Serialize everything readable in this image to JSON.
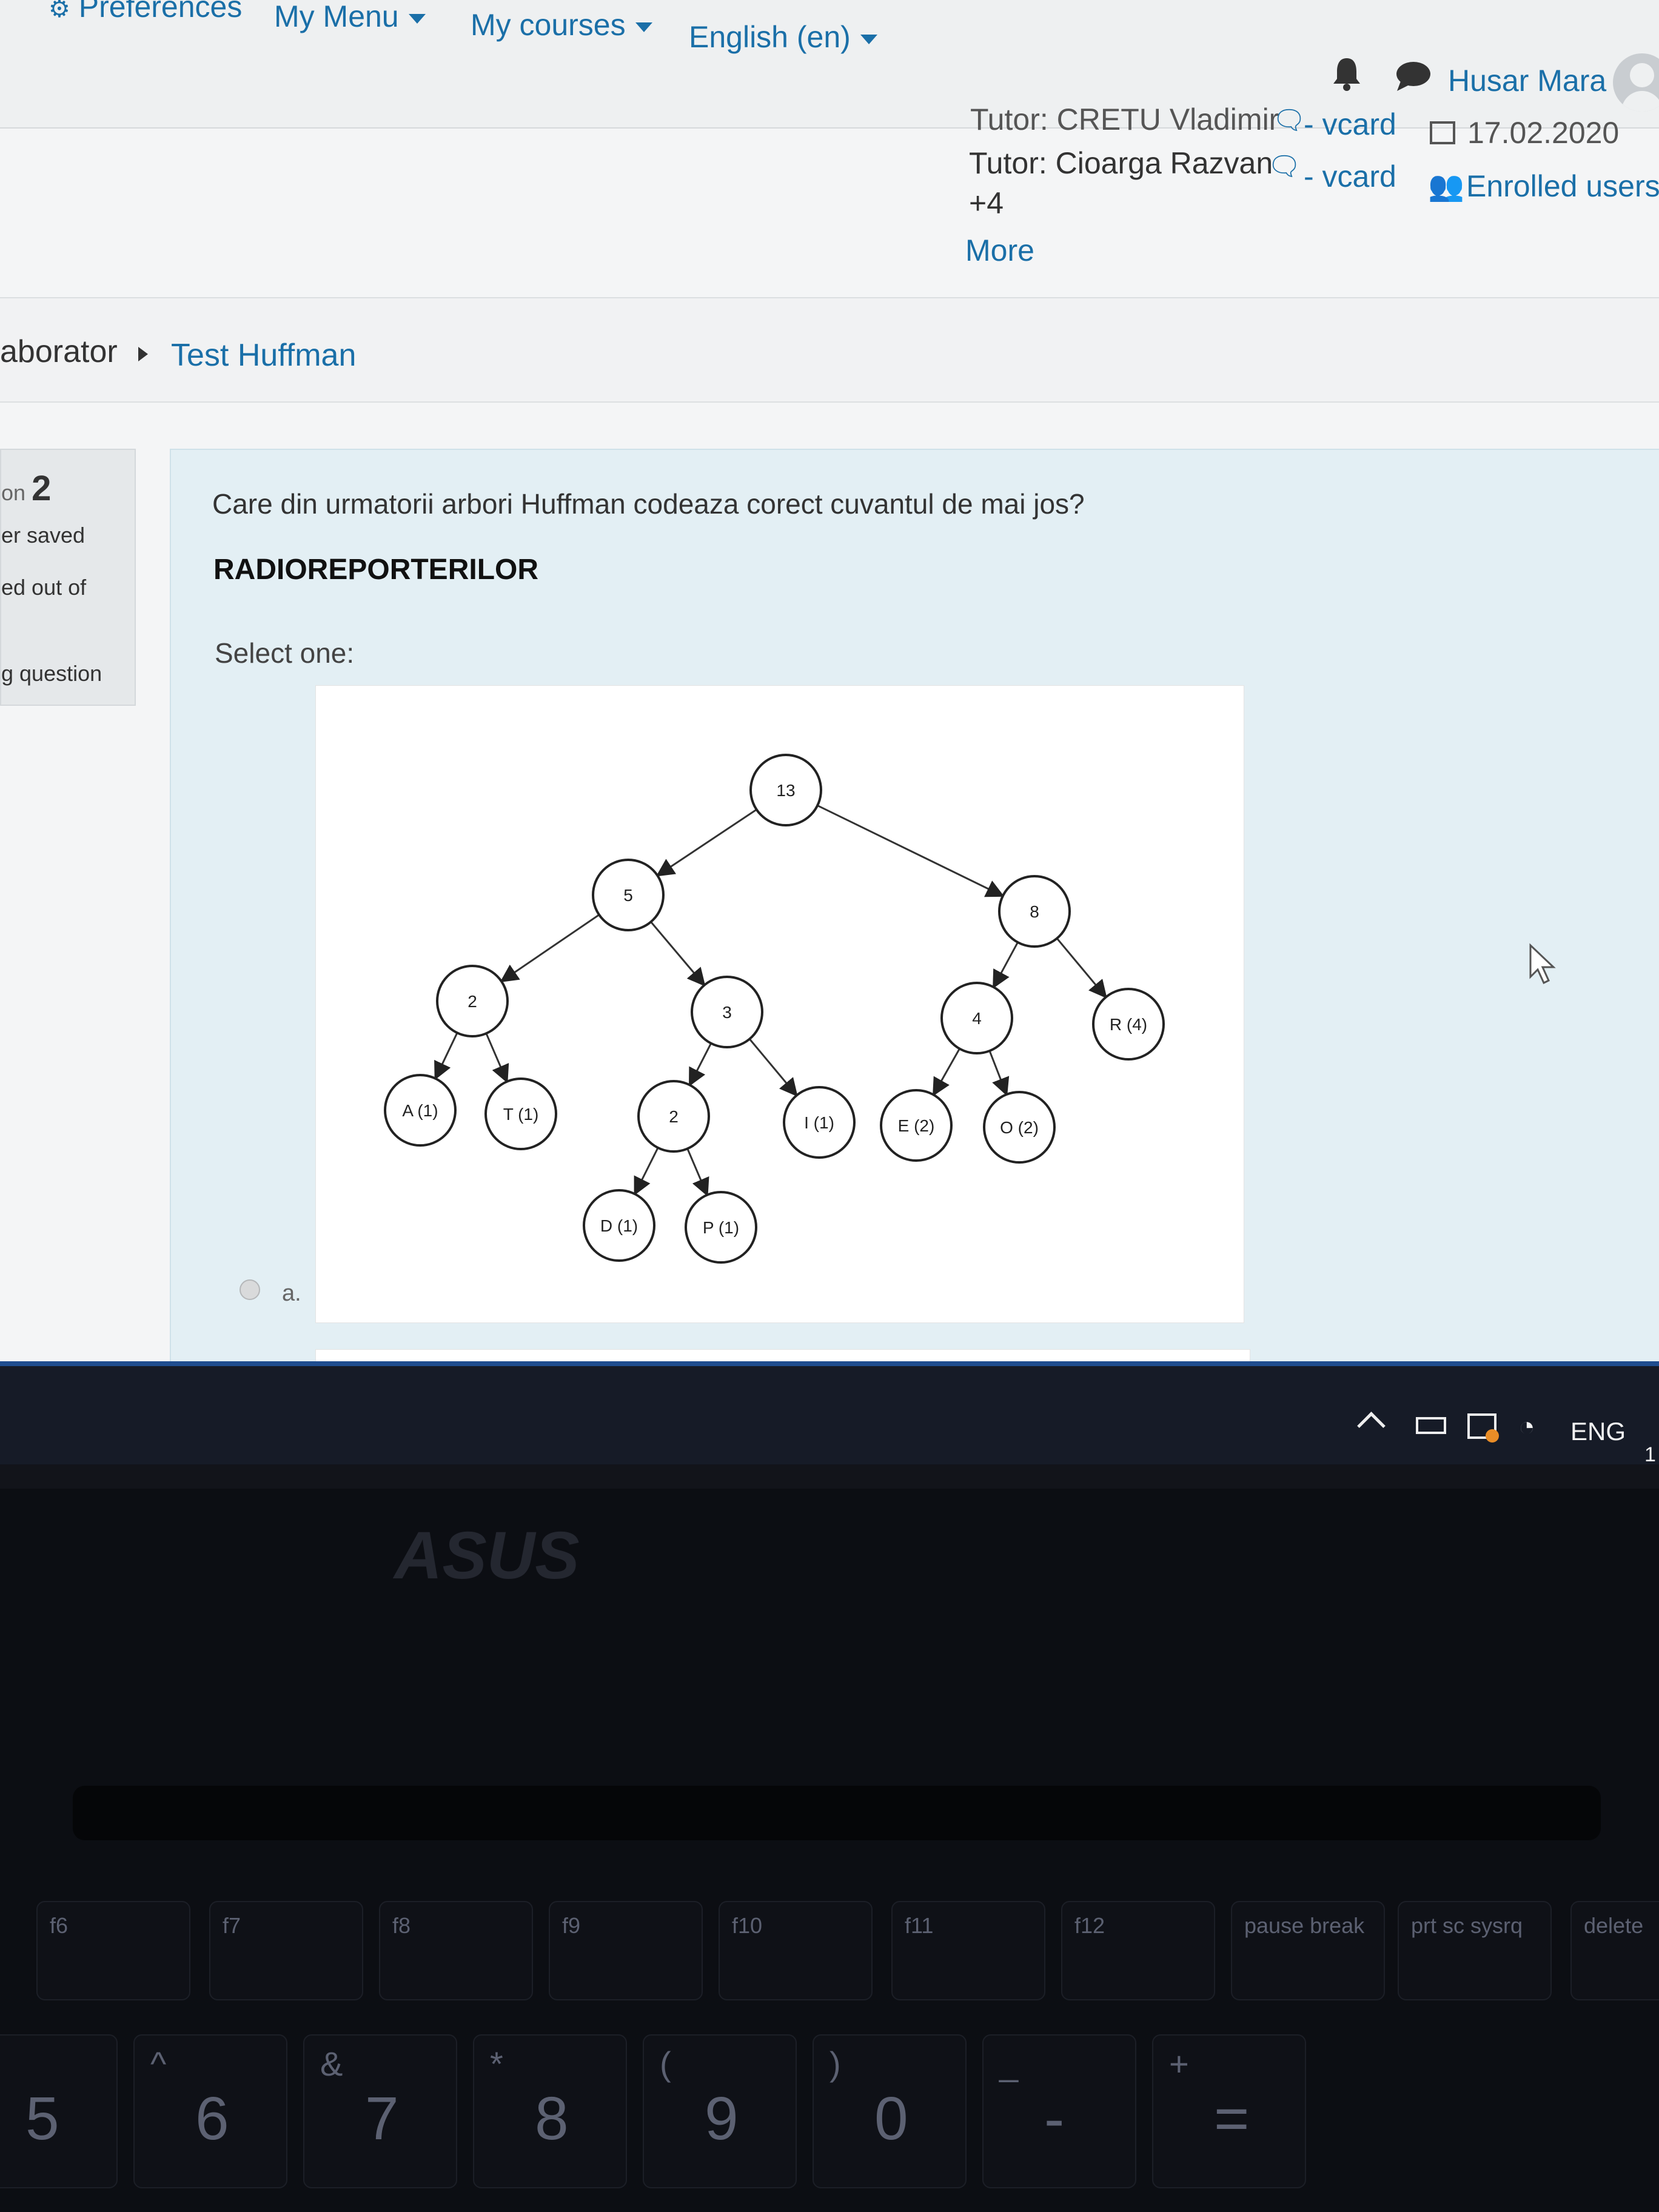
{
  "navbar": {
    "preferences": "Preferences",
    "my_menu": "My Menu",
    "my_courses": "My courses",
    "language": "English (en)",
    "user_name": "Husar Mara"
  },
  "course_header": {
    "tutor1_name": "Tutor: CRETU Vladimir",
    "vcard1": "- vcard",
    "date": "17.02.2020",
    "tutor2_name": "Tutor: Cioarga Razvan",
    "vcard2": "- vcard",
    "enrolled_users": "Enrolled users",
    "more_count": "+4",
    "more_link": "More"
  },
  "breadcrumb": {
    "item1": "aborator",
    "item2": "Test Huffman"
  },
  "question_info": {
    "number_prefix": "on",
    "number": "2",
    "status": "er saved",
    "marks": "ed out of",
    "flag": "g question"
  },
  "question": {
    "text": "Care din urmatorii arbori Huffman codeaza corect cuvantul de mai jos?",
    "word": "RADIOREPORTERILOR",
    "select_one": "Select one:",
    "option_a": "a."
  },
  "tree": {
    "nodes": [
      "13",
      "5",
      "8",
      "2",
      "3",
      "4",
      "R (4)",
      "A (1)",
      "T (1)",
      "2",
      "I (1)",
      "E (2)",
      "O (2)",
      "D (1)",
      "P (1)"
    ]
  },
  "taskbar": {
    "language": "ENG",
    "clock_peek": "1"
  },
  "laptop": {
    "brand": "ASUS",
    "keys_top": [
      "f6",
      "f7",
      "f8",
      "f9",
      "f10",
      "f11",
      "f12",
      "pause break",
      "prt sc sysrq",
      "delete"
    ],
    "keys_num": [
      "5",
      "6",
      "7",
      "8",
      "9",
      "0",
      "-",
      "="
    ],
    "keys_shift": [
      "^",
      "&",
      "*",
      "(",
      ")",
      "_",
      "+"
    ]
  }
}
